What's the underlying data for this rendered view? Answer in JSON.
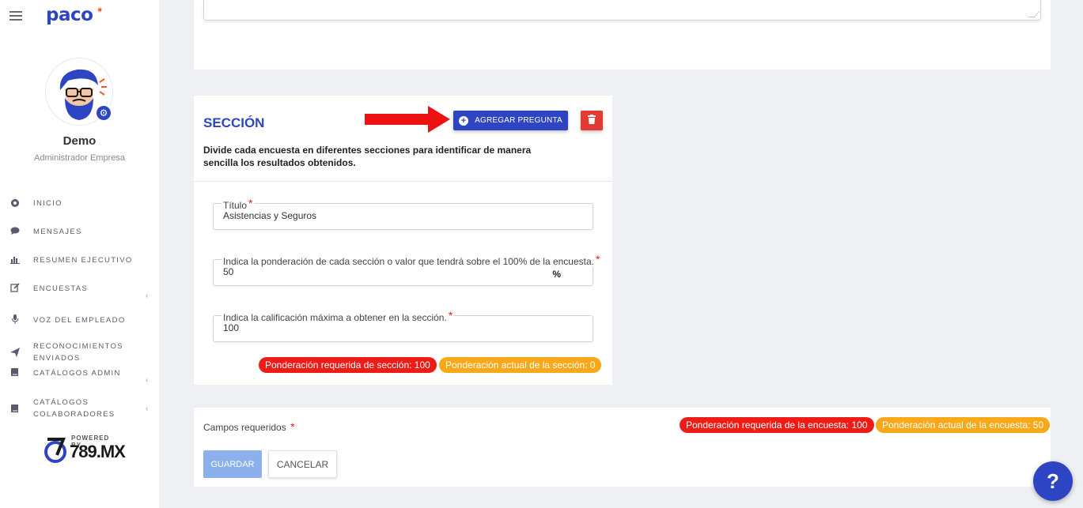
{
  "app": {
    "logo": "paco"
  },
  "user": {
    "name": "Demo",
    "role": "Administrador Empresa"
  },
  "sidebar": {
    "items": [
      {
        "label": "INICIO",
        "icon": "dashboard-icon"
      },
      {
        "label": "MENSAJES",
        "icon": "chat-bubble-icon"
      },
      {
        "label": "RESUMEN EJECUTIVO",
        "icon": "bar-chart-icon"
      },
      {
        "label": "ENCUESTAS",
        "icon": "edit-icon"
      },
      {
        "label": "VOZ DEL EMPLEADO",
        "icon": "microphone-icon"
      },
      {
        "label": "RECONOCIMIENTOS",
        "label2": "ENVIADOS",
        "icon": "send-icon"
      },
      {
        "label": "CATÁLOGOS ADMIN",
        "icon": "book-icon"
      },
      {
        "label": "CATÁLOGOS",
        "label2": "COLABORADORES",
        "icon": "book-icon"
      }
    ],
    "powered_by": "POWERED BY",
    "powered_brand": "789.MX"
  },
  "section": {
    "title": "SECCIÓN",
    "add_question_label": "AGREGAR PREGUNTA",
    "description": "Divide cada encuesta en diferentes secciones para identificar de manera sencilla los resultados obtenidos.",
    "fields": {
      "title_label": "Título",
      "title_value": "Asistencias y Seguros",
      "weight_label": "Indica la ponderación de cada sección o valor que tendrá sobre el 100% de la encuesta.",
      "weight_value": "50",
      "weight_suffix": "%",
      "max_score_label": "Indica la calificación máxima a obtener en la sección.",
      "max_score_value": "100"
    },
    "badges": {
      "required": "Ponderación requerida de sección: 100",
      "current": "Ponderación actual de la sección: 0"
    }
  },
  "footer": {
    "required_fields_label": "Campos requeridos",
    "required_survey_badge": "Ponderación requerida de la encuesta: 100",
    "current_survey_badge": "Ponderación actual de la encuesta: 50",
    "save_label": "GUARDAR",
    "cancel_label": "CANCELAR"
  },
  "required_mark": "*",
  "help_label": "?",
  "colors": {
    "primary": "#2d45c2",
    "danger": "#e33b33",
    "badge_red": "#ee1c17",
    "badge_orange": "#f9a81a",
    "save_disabled": "#8bb0ec"
  }
}
